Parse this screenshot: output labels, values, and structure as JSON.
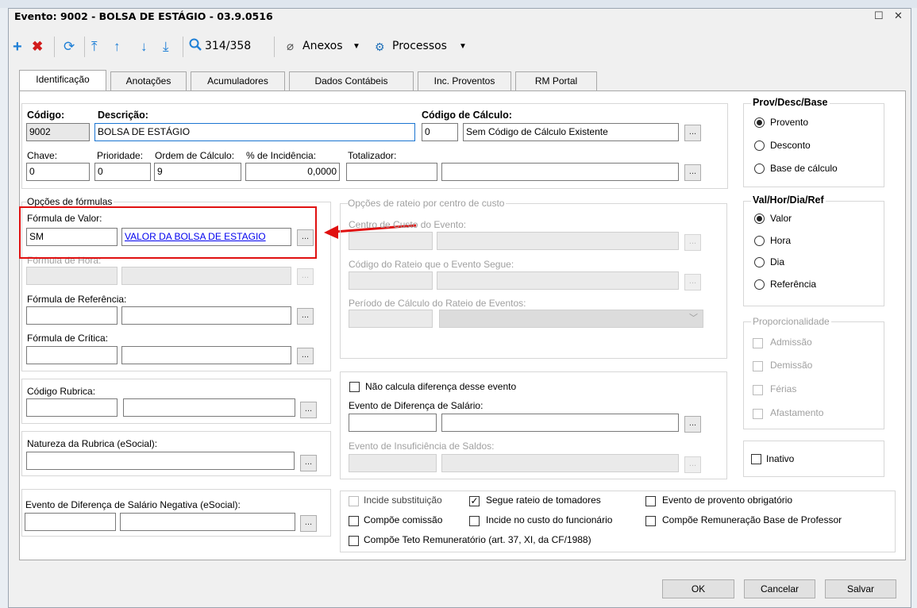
{
  "window": {
    "title": "Evento: 9002 - BOLSA DE ESTÁGIO - 03.9.0516",
    "restore_glyph": "☐",
    "close_glyph": "✕"
  },
  "toolbar": {
    "counter": "314/358",
    "attachments": "Anexos",
    "processes": "Processos"
  },
  "tabs": [
    "Identificação",
    "Anotações",
    "Acumuladores",
    "Dados Contábeis",
    "Inc. Proventos",
    "RM Portal"
  ],
  "form": {
    "codigo": {
      "label": "Código:",
      "value": "9002"
    },
    "descricao": {
      "label": "Descrição:",
      "value": "BOLSA DE ESTÁGIO"
    },
    "codigo_calculo": {
      "label": "Código de Cálculo:",
      "value": "0",
      "desc": "Sem Código de Cálculo Existente"
    },
    "chave": {
      "label": "Chave:",
      "value": "0"
    },
    "prioridade": {
      "label": "Prioridade:",
      "value": "0"
    },
    "ordem_calculo": {
      "label": "Ordem de Cálculo:",
      "value": "9"
    },
    "incidencia": {
      "label": "% de Incidência:",
      "value": "0,0000"
    },
    "totalizador": {
      "label": "Totalizador:",
      "value": ""
    }
  },
  "formulas": {
    "group": "Opções de fórmulas",
    "valor": {
      "label": "Fórmula de Valor:",
      "code": "SM",
      "desc": "VALOR DA BOLSA DE ESTAGIO"
    },
    "hora": {
      "label": "Fórmula de Hora:"
    },
    "referencia": {
      "label": "Fórmula de Referência:"
    },
    "critica": {
      "label": "Fórmula de Crítica:"
    }
  },
  "rubrica": {
    "codigo": "Código Rubrica:",
    "natureza": "Natureza da Rubrica (eSocial):",
    "evento_neg": "Evento de Diferença de Salário Negativa (eSocial):"
  },
  "rateio": {
    "group": "Opções de rateio por centro de custo",
    "centro": "Centro de Custo do Evento:",
    "codigo": "Código do Rateio que o Evento Segue:",
    "periodo": "Período de Cálculo do Rateio de Eventos:"
  },
  "diferenca": {
    "nao_calcula": "Não calcula diferença desse evento",
    "evento_dif": "Evento de Diferença de Salário:",
    "evento_insuf": "Evento de Insuficiência de Saldos:"
  },
  "checks": {
    "incide_subst": "Incide substituição",
    "segue_rateio": "Segue rateio de tomadores",
    "provento_obrig": "Evento de provento obrigatório",
    "compoe_comissao": "Compõe comissão",
    "incide_custo": "Incide no custo do funcionário",
    "compoe_remun": "Compõe Remuneração Base de Professor",
    "compoe_teto": "Compõe Teto Remuneratório (art. 37, XI, da CF/1988)",
    "check_mark": "✓"
  },
  "prov": {
    "title": "Prov/Desc/Base",
    "options": [
      "Provento",
      "Desconto",
      "Base de cálculo"
    ]
  },
  "valhor": {
    "title": "Val/Hor/Dia/Ref",
    "options": [
      "Valor",
      "Hora",
      "Dia",
      "Referência"
    ]
  },
  "proporc": {
    "title": "Proporcionalidade",
    "options": [
      "Admissão",
      "Demissão",
      "Férias",
      "Afastamento"
    ]
  },
  "inativo": "Inativo",
  "buttons": {
    "ok": "OK",
    "cancel": "Cancelar",
    "save": "Salvar"
  },
  "colors": {
    "accent": "#1a74d1",
    "annotation": "#e01010",
    "add": "#1e7fd6",
    "delete": "#d11b1b"
  }
}
